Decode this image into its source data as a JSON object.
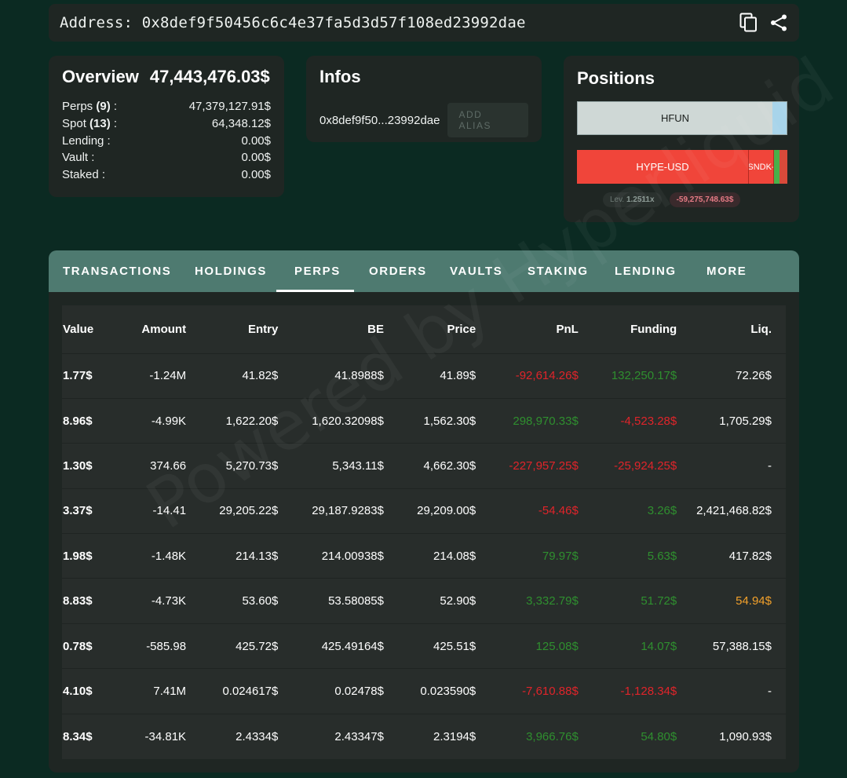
{
  "address_bar": {
    "label": "Address:",
    "address": "0x8def9f50456c6c4e37fa5d3d57f108ed23992dae",
    "icons": [
      "copy-icon",
      "share-icon"
    ]
  },
  "overview": {
    "title": "Overview",
    "total": "47,443,476.03$",
    "rows": [
      {
        "label": "Perps",
        "count": "(9)",
        "suffix": " :",
        "value": "47,379,127.91$"
      },
      {
        "label": "Spot",
        "count": "(13)",
        "suffix": " :",
        "value": "64,348.12$"
      },
      {
        "label": "Lending :",
        "count": "",
        "suffix": "",
        "value": "0.00$"
      },
      {
        "label": "Vault :",
        "count": "",
        "suffix": "",
        "value": "0.00$"
      },
      {
        "label": "Staked :",
        "count": "",
        "suffix": "",
        "value": "0.00$"
      }
    ]
  },
  "infos": {
    "title": "Infos",
    "short_address": "0x8def9f50...23992dae",
    "add_alias_label": "ADD ALIAS"
  },
  "positions": {
    "title": "Positions",
    "bar1_label": "HFUN",
    "bar2_label": "HYPE-USD",
    "bar2_small_label": "SNDK-",
    "lev_label": "Lev.",
    "lev_value": "1.2511x",
    "pnl_value": "-59,275,748.63$"
  },
  "tabs": [
    {
      "label": "TRANSACTIONS",
      "active": false
    },
    {
      "label": "HOLDINGS",
      "active": false
    },
    {
      "label": "PERPS",
      "active": true
    },
    {
      "label": "ORDERS",
      "active": false
    },
    {
      "label": "VAULTS",
      "active": false
    },
    {
      "label": "STAKING",
      "active": false
    },
    {
      "label": "LENDING",
      "active": false
    },
    {
      "label": "MORE",
      "active": false
    }
  ],
  "table": {
    "headers": [
      "Value",
      "Amount",
      "Entry",
      "BE",
      "Price",
      "PnL",
      "Funding",
      "Liq."
    ],
    "rows": [
      {
        "value": "1.77$",
        "amount": "-1.24M",
        "entry": "41.82$",
        "be": "41.8988$",
        "price": "41.89$",
        "pnl": "-92,614.26$",
        "pnl_sign": "neg",
        "funding": "132,250.17$",
        "funding_sign": "pos",
        "liq": "72.26$",
        "liq_style": ""
      },
      {
        "value": "8.96$",
        "amount": "-4.99K",
        "entry": "1,622.20$",
        "be": "1,620.32098$",
        "price": "1,562.30$",
        "pnl": "298,970.33$",
        "pnl_sign": "pos",
        "funding": "-4,523.28$",
        "funding_sign": "neg",
        "liq": "1,705.29$",
        "liq_style": ""
      },
      {
        "value": "1.30$",
        "amount": "374.66",
        "entry": "5,270.73$",
        "be": "5,343.11$",
        "price": "4,662.30$",
        "pnl": "-227,957.25$",
        "pnl_sign": "neg",
        "funding": "-25,924.25$",
        "funding_sign": "neg",
        "liq": "-",
        "liq_style": ""
      },
      {
        "value": "3.37$",
        "amount": "-14.41",
        "entry": "29,205.22$",
        "be": "29,187.9283$",
        "price": "29,209.00$",
        "pnl": "-54.46$",
        "pnl_sign": "neg",
        "funding": "3.26$",
        "funding_sign": "pos",
        "liq": "2,421,468.82$",
        "liq_style": ""
      },
      {
        "value": "1.98$",
        "amount": "-1.48K",
        "entry": "214.13$",
        "be": "214.00938$",
        "price": "214.08$",
        "pnl": "79.97$",
        "pnl_sign": "pos",
        "funding": "5.63$",
        "funding_sign": "pos",
        "liq": "417.82$",
        "liq_style": ""
      },
      {
        "value": "8.83$",
        "amount": "-4.73K",
        "entry": "53.60$",
        "be": "53.58085$",
        "price": "52.90$",
        "pnl": "3,332.79$",
        "pnl_sign": "pos",
        "funding": "51.72$",
        "funding_sign": "pos",
        "liq": "54.94$",
        "liq_style": "warn"
      },
      {
        "value": "0.78$",
        "amount": "-585.98",
        "entry": "425.72$",
        "be": "425.49164$",
        "price": "425.51$",
        "pnl": "125.08$",
        "pnl_sign": "pos",
        "funding": "14.07$",
        "funding_sign": "pos",
        "liq": "57,388.15$",
        "liq_style": ""
      },
      {
        "value": "4.10$",
        "amount": "7.41M",
        "entry": "0.024617$",
        "be": "0.02478$",
        "price": "0.023590$",
        "pnl": "-7,610.88$",
        "pnl_sign": "neg",
        "funding": "-1,128.34$",
        "funding_sign": "neg",
        "liq": "-",
        "liq_style": ""
      },
      {
        "value": "8.34$",
        "amount": "-34.81K",
        "entry": "2.4334$",
        "be": "2.43347$",
        "price": "2.3194$",
        "pnl": "3,966.76$",
        "pnl_sign": "pos",
        "funding": "54.80$",
        "funding_sign": "pos",
        "liq": "1,090.93$",
        "liq_style": ""
      }
    ]
  },
  "watermark": "Powered by Hyperliquid",
  "colors": {
    "background": "#0b2a22",
    "card": "#1f2623",
    "tab_bar": "#4e7a70",
    "positive": "#2f8f2f",
    "negative": "#e0242a",
    "warning": "#f3a12b"
  }
}
